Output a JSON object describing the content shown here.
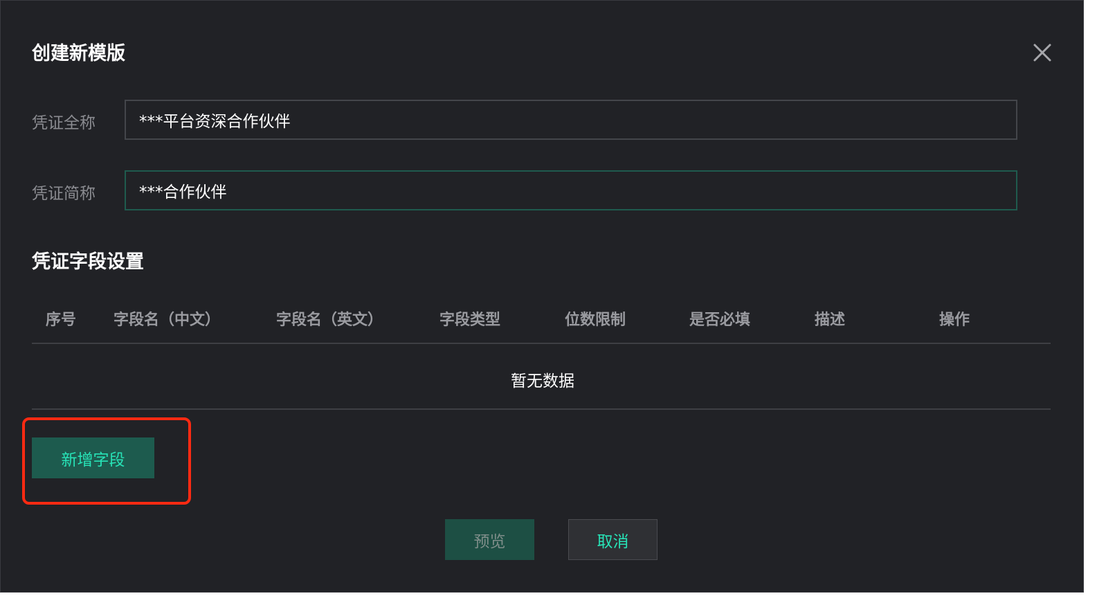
{
  "dialog": {
    "title": "创建新模版",
    "close_icon": "close-icon"
  },
  "form": {
    "full_name_label": "凭证全称",
    "full_name_value": "***平台资深合作伙伴",
    "short_name_label": "凭证简称",
    "short_name_value": "***合作伙伴"
  },
  "fields_section": {
    "title": "凭证字段设置",
    "columns": [
      "序号",
      "字段名（中文）",
      "字段名（英文）",
      "字段类型",
      "位数限制",
      "是否必填",
      "描述",
      "操作"
    ],
    "empty_text": "暂无数据",
    "add_button_label": "新增字段"
  },
  "footer": {
    "preview_label": "预览",
    "cancel_label": "取消"
  },
  "colors": {
    "background": "#212226",
    "accent_text": "#27e3b7",
    "primary_button": "#1d5b4e",
    "highlight": "#ff2a12"
  }
}
